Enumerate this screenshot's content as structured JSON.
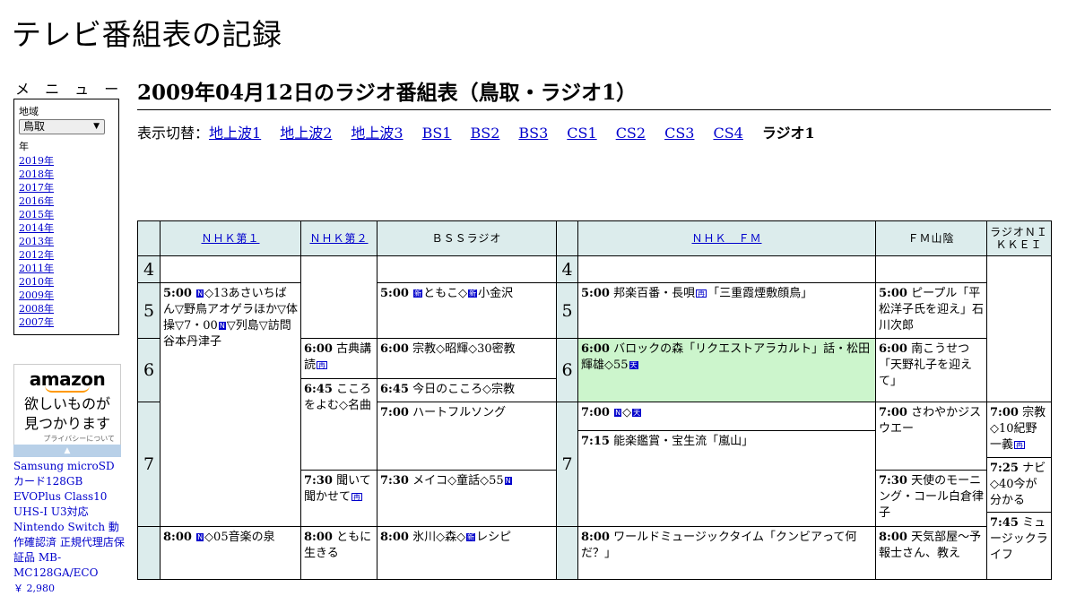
{
  "site_title": "テレビ番組表の記録",
  "menu": {
    "heading": "メ ニ ュ ー",
    "region_label": "地域",
    "region_value": "鳥取",
    "year_label": "年",
    "years": [
      "2019年",
      "2018年",
      "2017年",
      "2016年",
      "2015年",
      "2014年",
      "2013年",
      "2012年",
      "2011年",
      "2010年",
      "2009年",
      "2008年",
      "2007年"
    ]
  },
  "ad": {
    "logo": "amazon",
    "text_line1": "欲しいものが",
    "text_line2": "見つかります",
    "privacy": "プライバシーについて",
    "product_title": "Samsung microSDカード128GB EVOPlus Class10 UHS-I U3対応 Nintendo Switch 動作確認済 正規代理店保証品 MB-MC128GA/ECO",
    "price": "￥ 2,980"
  },
  "heading": "2009年04月12日のラジオ番組表（鳥取・ラジオ1）",
  "switcher": {
    "label": "表示切替：",
    "links": [
      "地上波1",
      "地上波2",
      "地上波3",
      "BS1",
      "BS2",
      "BS3",
      "CS1",
      "CS2",
      "CS3",
      "CS4"
    ],
    "current": "ラジオ1"
  },
  "table": {
    "columns": [
      "ＮＨＫ第１",
      "ＮＨＫ第２",
      "ＢＳＳラジオ",
      "ＮＨＫ　ＦＭ",
      "ＦＭ山陰",
      "ラジオＮＩＫＫＥＩ"
    ],
    "hours": [
      "4",
      "5",
      "6",
      "7"
    ],
    "hours_right": [
      "4",
      "5",
      "6",
      "7"
    ],
    "programs": {
      "nhk1_500_t": "5:00",
      "nhk1_500": "◇13あさいちばん▽野鳥アオゲラほか▽体操▽7・00",
      "nhk1_500b": "▽列島▽訪問　谷本丹津子",
      "nhk1_800_t": "8:00",
      "nhk1_800": "◇05音楽の泉",
      "nhk2_600_t": "6:00",
      "nhk2_600": "古典講読",
      "nhk2_645_t": "6:45",
      "nhk2_645": "こころをよむ◇名曲",
      "nhk2_730_t": "7:30",
      "nhk2_730": "聞いて聞かせて",
      "nhk2_800_t": "8:00",
      "nhk2_800": "ともに生きる",
      "bss_500_t": "5:00",
      "bss_500a": "ともこ◇",
      "bss_500b": "小金沢",
      "bss_600_t": "6:00",
      "bss_600": "宗教◇昭輝◇30密教",
      "bss_645_t": "6:45",
      "bss_645": "今日のこころ◇宗教",
      "bss_700_t": "7:00",
      "bss_700": "ハートフルソング",
      "bss_730_t": "7:30",
      "bss_730": "メイコ◇童話◇55",
      "bss_800_t": "8:00",
      "bss_800a": "氷川◇森◇",
      "bss_800b": "レシピ",
      "fm_500_t": "5:00",
      "fm_500a": "邦楽百番・長唄",
      "fm_500b": "「三重霞煙敷顔鳥」",
      "fm_600_t": "6:00",
      "fm_600": "バロックの森「リクエストアラカルト」話・松田輝雄◇55",
      "fm_700_t": "7:00",
      "fm_700": "◇",
      "fm_715_t": "7:15",
      "fm_715": "能楽鑑賞・宝生流「嵐山」",
      "fm_800_t": "8:00",
      "fm_800": "ワールドミュージックタイム「クンビアって何だ？」",
      "fms_500_t": "5:00",
      "fms_500": "ピープル「平松洋子氏を迎え」石川次郎",
      "fms_600_t": "6:00",
      "fms_600": "南こうせつ「天野礼子を迎えて」",
      "fms_700_t": "7:00",
      "fms_700": "さわやかジスウエー",
      "fms_730_t": "7:30",
      "fms_730": "天使のモーニング・コール白倉律子",
      "fms_800_t": "8:00",
      "fms_800": "天気部屋～予報士さん、教え",
      "nk_700_t": "7:00",
      "nk_700": "宗教◇10紀野一義",
      "nk_725_t": "7:25",
      "nk_725": "ナビ◇40今が分かる",
      "nk_745_t": "7:45",
      "nk_745": "ミュージックライフ"
    },
    "icons": {
      "news": "N",
      "new": "新",
      "rebroadcast": "再",
      "weather": "天"
    }
  },
  "colors": {
    "header_bg": "#dcecec",
    "highlight_bg": "#ccf5cc",
    "link": "#0000cc"
  }
}
